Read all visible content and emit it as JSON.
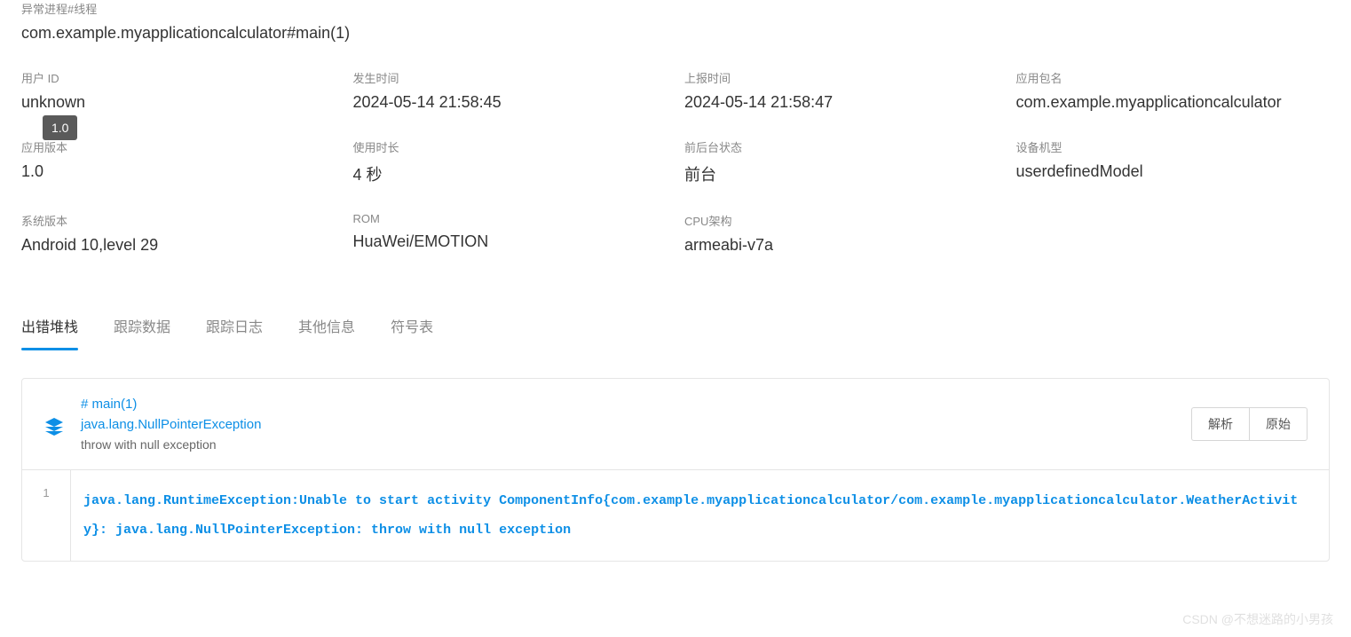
{
  "header": {
    "label": "异常进程#线程",
    "value": "com.example.myapplicationcalculator#main(1)"
  },
  "tooltip": "1.0",
  "info": [
    {
      "label": "用户 ID",
      "value": "unknown"
    },
    {
      "label": "发生时间",
      "value": "2024-05-14 21:58:45"
    },
    {
      "label": "上报时间",
      "value": "2024-05-14 21:58:47"
    },
    {
      "label": "应用包名",
      "value": "com.example.myapplicationcalculator"
    },
    {
      "label": "应用版本",
      "value": "1.0"
    },
    {
      "label": "使用时长",
      "value": "4 秒"
    },
    {
      "label": "前后台状态",
      "value": "前台"
    },
    {
      "label": "设备机型",
      "value": "userdefinedModel"
    },
    {
      "label": "系统版本",
      "value": "Android 10,level 29"
    },
    {
      "label": "ROM",
      "value": "HuaWei/EMOTION"
    },
    {
      "label": "CPU架构",
      "value": "armeabi-v7a"
    }
  ],
  "tabs": [
    {
      "label": "出错堆栈",
      "active": true
    },
    {
      "label": "跟踪数据",
      "active": false
    },
    {
      "label": "跟踪日志",
      "active": false
    },
    {
      "label": "其他信息",
      "active": false
    },
    {
      "label": "符号表",
      "active": false
    }
  ],
  "stack": {
    "thread": "# main(1)",
    "exception": "java.lang.NullPointerException",
    "message": "throw with null exception",
    "buttons": {
      "parse": "解析",
      "raw": "原始"
    },
    "line_number": "1",
    "trace": "java.lang.RuntimeException:Unable to start activity ComponentInfo{com.example.myapplicationcalculator/com.example.myapplicationcalculator.WeatherActivity}: java.lang.NullPointerException: throw with null exception"
  },
  "watermark": "CSDN @不想迷路的小男孩"
}
